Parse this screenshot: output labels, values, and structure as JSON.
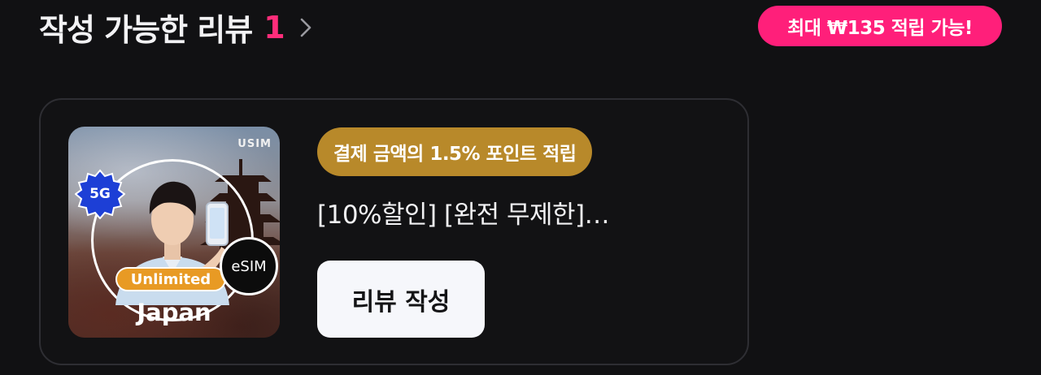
{
  "header": {
    "title": "작성 가능한 리뷰",
    "count": "1",
    "reward_badge": "최대 ₩135 적립 가능!"
  },
  "review_card": {
    "thumbnail": {
      "brand": "USIM",
      "network_badge": "5G",
      "plan_badge": "Unlimited",
      "sim_badge": "eSIM",
      "country": "Japan"
    },
    "point_badge": "결제 금액의 1.5% 포인트 적립",
    "product_title": "[10%할인] [완전 무제한]…",
    "write_review_label": "리뷰 작성"
  },
  "colors": {
    "background": "#111113",
    "accent_pink": "#ff1f7a",
    "point_gold": "#b8892a",
    "card_border": "#2e2e33"
  }
}
